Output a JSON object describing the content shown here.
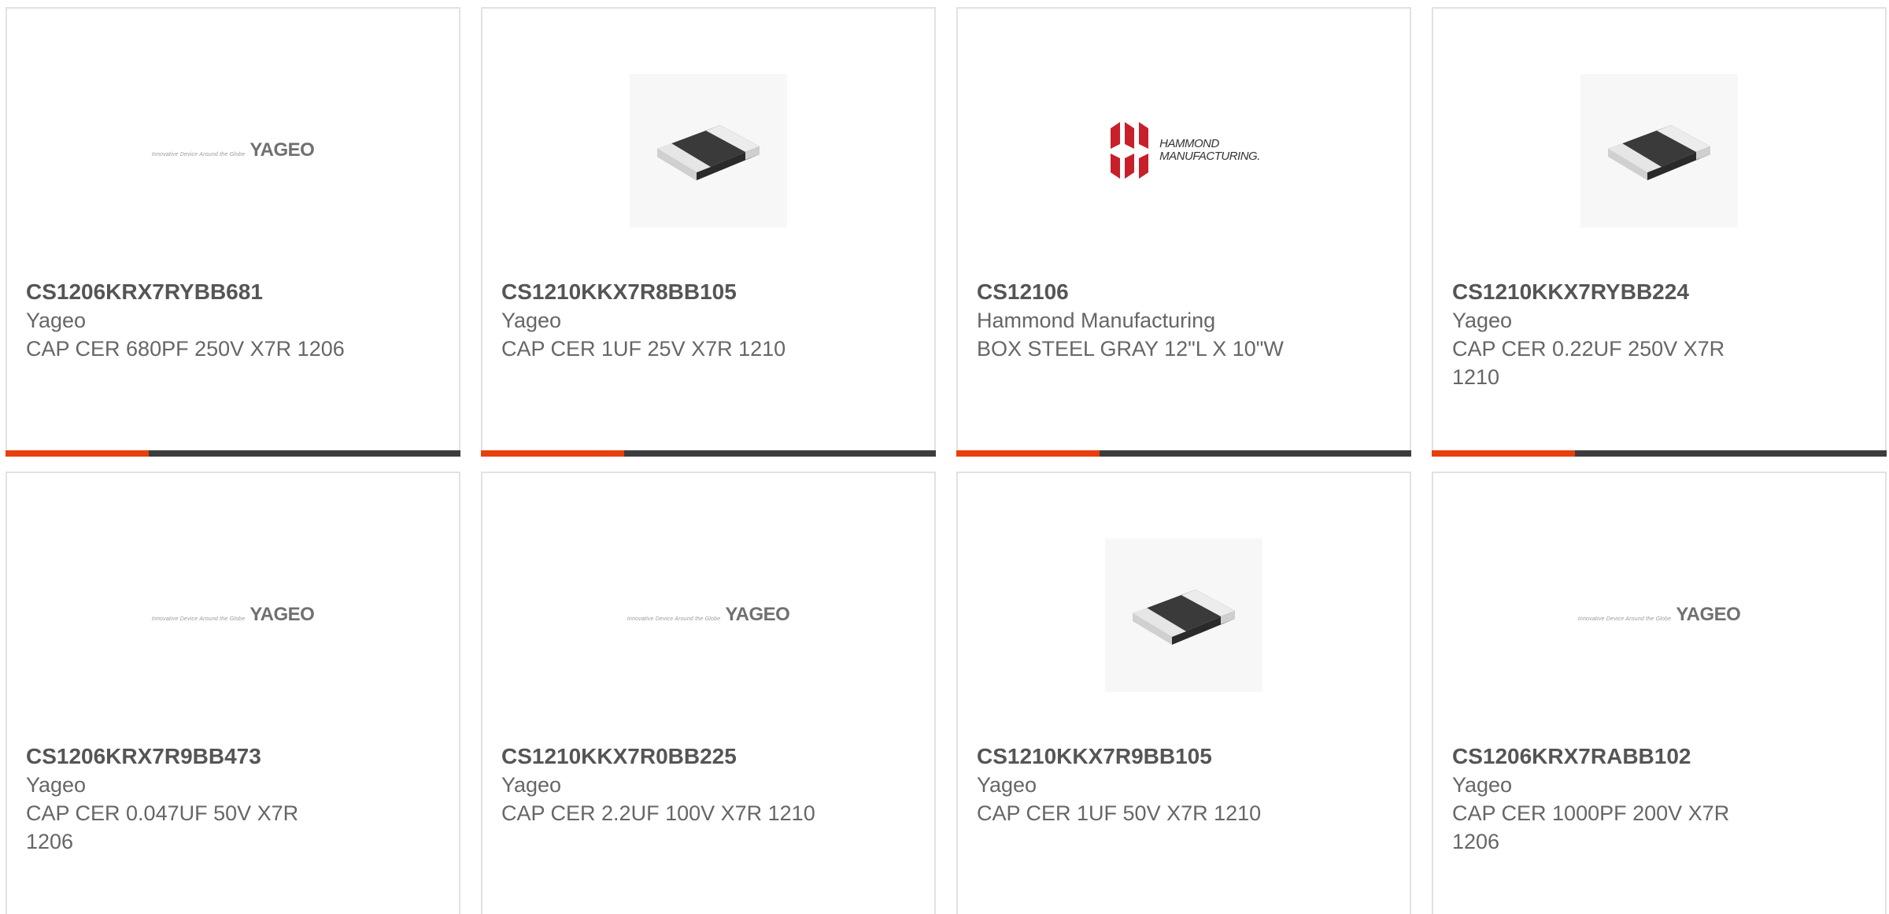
{
  "products": [
    {
      "part_number": "CS1206KRX7RYBB681",
      "manufacturer": "Yageo",
      "description": "CAP CER 680PF 250V X7R 1206",
      "image": "yageo-logo"
    },
    {
      "part_number": "CS1210KKX7R8BB105",
      "manufacturer": "Yageo",
      "description": "CAP CER 1UF 25V X7R 1210",
      "image": "chip-capacitor"
    },
    {
      "part_number": "CS12106",
      "manufacturer": "Hammond Manufacturing",
      "description": "BOX STEEL GRAY 12\"L X 10\"W",
      "image": "hammond-logo"
    },
    {
      "part_number": "CS1210KKX7RYBB224",
      "manufacturer": "Yageo",
      "description": "CAP CER 0.22UF 250V X7R 1210",
      "image": "chip-capacitor"
    },
    {
      "part_number": "CS1206KRX7R9BB473",
      "manufacturer": "Yageo",
      "description": "CAP CER 0.047UF 50V X7R 1206",
      "image": "yageo-logo"
    },
    {
      "part_number": "CS1210KKX7R0BB225",
      "manufacturer": "Yageo",
      "description": "CAP CER 2.2UF 100V X7R 1210",
      "image": "yageo-logo"
    },
    {
      "part_number": "CS1210KKX7R9BB105",
      "manufacturer": "Yageo",
      "description": "CAP CER 1UF 50V X7R 1210",
      "image": "chip-capacitor"
    },
    {
      "part_number": "CS1206KRX7RABB102",
      "manufacturer": "Yageo",
      "description": "CAP CER 1000PF 200V X7R 1206",
      "image": "yageo-logo"
    }
  ],
  "logos": {
    "yageo_tagline": "Innovative Device Around the Globe",
    "yageo_word": "YAGEO",
    "hammond_line1": "HAMMOND",
    "hammond_line2": "MANUFACTURING."
  },
  "colors": {
    "accent": "#e8400c",
    "bar": "#3d3d3d",
    "border": "#e2e2e2",
    "hammond_red": "#c8202a"
  }
}
